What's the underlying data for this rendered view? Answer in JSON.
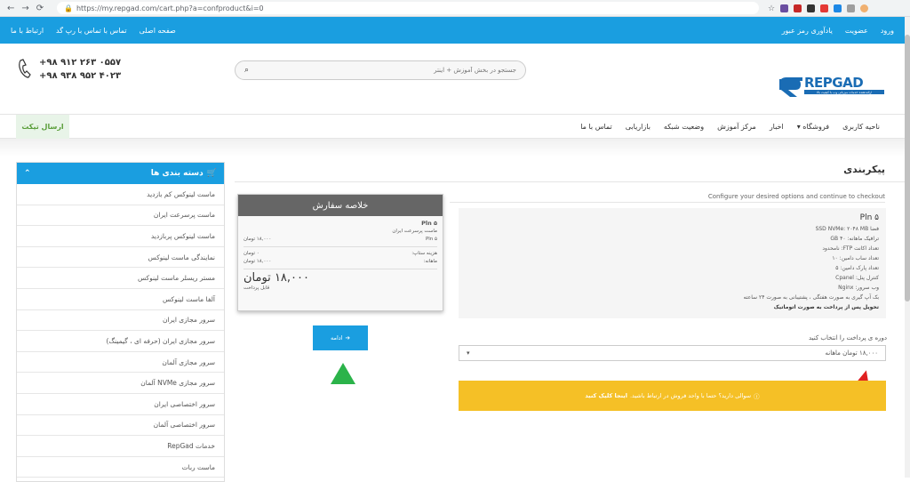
{
  "browser": {
    "url": "https://my.repgad.com/cart.php?a=confproduct&i=0"
  },
  "topbar": {
    "right_links": [
      "ورود",
      "عضویت",
      "یادآوری رمز عبور"
    ],
    "left_links": [
      "صفحه اصلی",
      "تماس با تماس با رپ گد",
      "ارتباط با ما"
    ]
  },
  "header": {
    "logo_text": "REPGAD",
    "logo_tagline": "ارائه‌دهنده خدمات میزبانی وب با کیفیت بالا",
    "search_placeholder": "جستجو در بخش آموزش + اینتر",
    "phone1": "+۹۸ ۹۱۲ ۲۶۳ ۰۵۵۷",
    "phone2": "+۹۸ ۹۳۸ ۹۵۲ ۴۰۲۳"
  },
  "nav": {
    "items": [
      "ناحیه کاربری",
      "فروشگاه ▾",
      "اخبار",
      "مرکز آموزش",
      "وضعیت شبکه",
      "بازاریابی",
      "تماس با ما"
    ],
    "ticket": "ارسال تیکت"
  },
  "sidebar": {
    "title": "دسته بندی ها",
    "items": [
      "ماست لینوکس کم بازدید",
      "ماست پرسرعت ایران",
      "ماست لینوکس پربازدید",
      "نمایندگی ماست لینوکس",
      "مستر ریسلر ماست لینوکس",
      "آلفا ماست لینوکس",
      "سرور مجازی ایران",
      "سرور مجازی ایران (حرفه ای ، گیمینگ)",
      "سرور مجازی آلمان",
      "سرور مجازی NVMe آلمان",
      "سرور اختصاصی ایران",
      "سرور اختصاصی آلمان",
      "خدمات RepGad",
      "ماست ربات"
    ]
  },
  "page": {
    "title": "پیکربندی",
    "hint": "Configure your desired options and continue to checkout",
    "product": {
      "name": "Pln ۵",
      "lines": [
        "فضا SSD NVMe: ۲۰۴۸ MB",
        "ترافیک ماهانه: ۴۰ GB",
        "تعداد اکانت FTP: نامحدود",
        "تعداد ساب دامین: ۱۰",
        "تعداد پارک دامین: ۵",
        "کنترل پنل: Cpanel",
        "وب سرور: Nginx"
      ],
      "backup_line": "بک آپ گیری به صورت هفتگی ، پشتیبانی به صورت ۲۴ ساعته",
      "delivery_line": "تحویل پس از پرداخت به صورت اتوماتیک"
    },
    "billing_label": "دوره ی پرداخت را انتخاب کنید",
    "billing_value": "۱۸,۰۰۰ تومان ماهانه",
    "notice_text": "سوالی دارید؟ حتما با واحد فروش در ارتباط باشید.",
    "notice_link": "اینجا کلیک کنید"
  },
  "summary": {
    "title": "خلاصه سفارش",
    "product_name": "Pln ۵",
    "product_group": "ماست پرسرعت ایران",
    "line_label": "Pln ۵",
    "line_price": "۱۸,۰۰۰ تومان",
    "setup_label": "هزینه ستاپ:",
    "setup_value": "۰ تومان",
    "monthly_label": "ماهانه:",
    "monthly_value": "۱۸,۰۰۰ تومان",
    "total": "۱۸,۰۰۰ تومان",
    "total_label": "قابل پرداخت",
    "continue": "ادامه"
  }
}
